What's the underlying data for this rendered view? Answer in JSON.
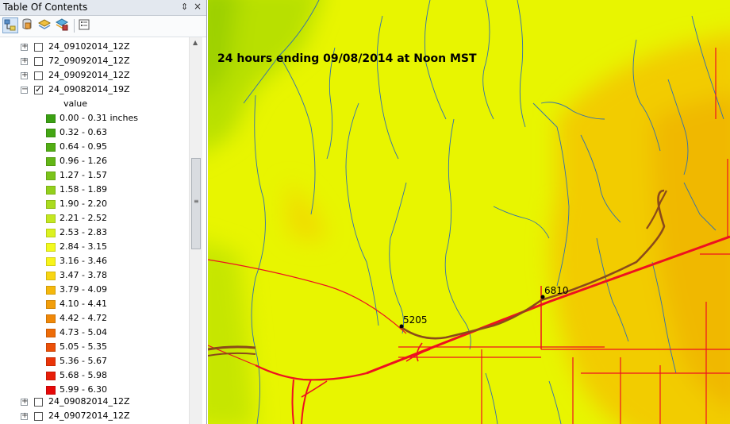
{
  "toc": {
    "title": "Table Of Contents",
    "pin_glyph": "⇕",
    "close_glyph": "×",
    "toolbar": [
      "list-by-drawing-order-icon",
      "list-by-source-icon",
      "list-by-visibility-icon",
      "list-by-selection-icon",
      "options-icon"
    ],
    "layers_top": [
      {
        "name": "24_09102014_12Z",
        "checked": false
      },
      {
        "name": "72_09092014_12Z",
        "checked": false
      },
      {
        "name": "24_09092014_12Z",
        "checked": false
      }
    ],
    "expanded_layer": {
      "name": "24_09082014_19Z",
      "checked": true
    },
    "legend_heading": "value",
    "legend": [
      {
        "label": "0.00 - 0.31 inches",
        "color": "#3aa012"
      },
      {
        "label": "0.32 - 0.63",
        "color": "#44a614"
      },
      {
        "label": "0.64 - 0.95",
        "color": "#52ae14"
      },
      {
        "label": "0.96 - 1.26",
        "color": "#63b616"
      },
      {
        "label": "1.27 - 1.57",
        "color": "#7bc41a"
      },
      {
        "label": "1.58 - 1.89",
        "color": "#93d01c"
      },
      {
        "label": "1.90 - 2.20",
        "color": "#aadc1e"
      },
      {
        "label": "2.21 - 2.52",
        "color": "#c4e820"
      },
      {
        "label": "2.53 - 2.83",
        "color": "#dcf220"
      },
      {
        "label": "2.84 - 3.15",
        "color": "#f2fa1e"
      },
      {
        "label": "3.16 - 3.46",
        "color": "#f8f41a"
      },
      {
        "label": "3.47 - 3.78",
        "color": "#f8d612"
      },
      {
        "label": "3.79 - 4.09",
        "color": "#f5b80c"
      },
      {
        "label": "4.10 - 4.41",
        "color": "#f29e0a"
      },
      {
        "label": "4.42 - 4.72",
        "color": "#f08808"
      },
      {
        "label": "4.73 - 5.04",
        "color": "#ee6c08"
      },
      {
        "label": "5.05 - 5.35",
        "color": "#ec5008"
      },
      {
        "label": "5.36 - 5.67",
        "color": "#ea3408"
      },
      {
        "label": "5.68 - 5.98",
        "color": "#e81e08"
      },
      {
        "label": "5.99 - 6.30",
        "color": "#e60808"
      }
    ],
    "layers_bottom": [
      {
        "name": "24_09082014_12Z",
        "checked": false
      },
      {
        "name": "24_09072014_12Z",
        "checked": false
      }
    ]
  },
  "map": {
    "title": "24 hours ending 09/08/2014 at Noon MST",
    "gauges": [
      {
        "label": "5205"
      },
      {
        "label": "6810"
      }
    ],
    "colors": {
      "green": "#b8e000",
      "yellow": "#e8f500",
      "orange": "#f0c400",
      "river": "#2f6fb0",
      "road": "#ee1020",
      "trail": "#8a4a1a"
    }
  }
}
